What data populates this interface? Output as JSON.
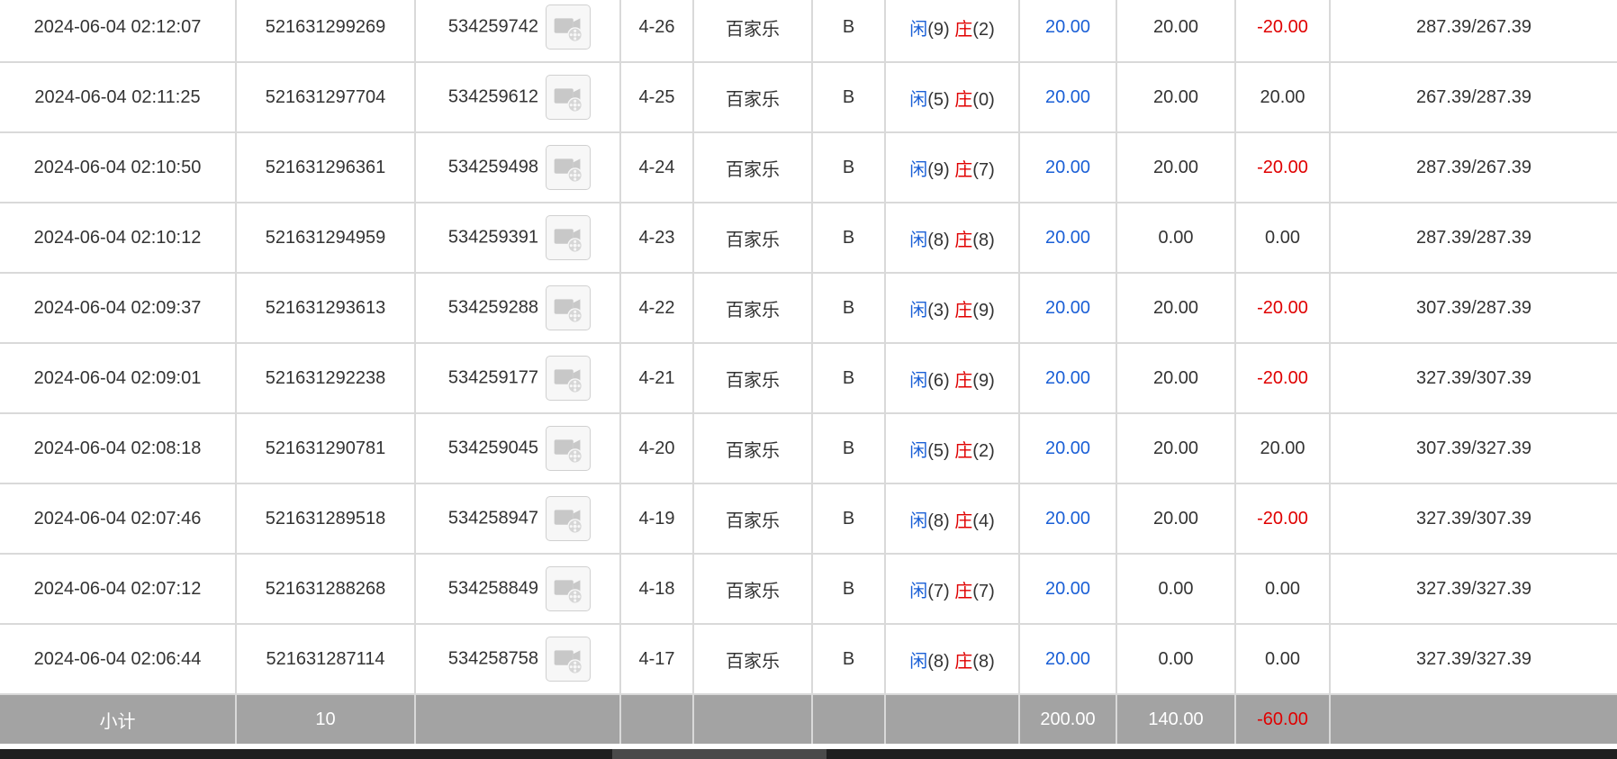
{
  "colors": {
    "player": "#1a5fd6",
    "banker": "#e00000",
    "negative": "#e00000",
    "subtotal_bg": "#a3a3a3"
  },
  "icons": {
    "video": "video-replay-icon"
  },
  "rows": [
    {
      "time": "2024-06-04 02:12:07",
      "bet_id": "521631299269",
      "game_id": "534259742",
      "round": "4-26",
      "game": "百家乐",
      "bet": "B",
      "player_label": "闲",
      "player": "(9)",
      "banker_label": "庄",
      "banker": "(2)",
      "bet_amount": "20.00",
      "valid_amount": "20.00",
      "win_loss": "-20.00",
      "negative": true,
      "balance": "287.39/267.39"
    },
    {
      "time": "2024-06-04 02:11:25",
      "bet_id": "521631297704",
      "game_id": "534259612",
      "round": "4-25",
      "game": "百家乐",
      "bet": "B",
      "player_label": "闲",
      "player": "(5)",
      "banker_label": "庄",
      "banker": "(0)",
      "bet_amount": "20.00",
      "valid_amount": "20.00",
      "win_loss": "20.00",
      "negative": false,
      "balance": "267.39/287.39"
    },
    {
      "time": "2024-06-04 02:10:50",
      "bet_id": "521631296361",
      "game_id": "534259498",
      "round": "4-24",
      "game": "百家乐",
      "bet": "B",
      "player_label": "闲",
      "player": "(9)",
      "banker_label": "庄",
      "banker": "(7)",
      "bet_amount": "20.00",
      "valid_amount": "20.00",
      "win_loss": "-20.00",
      "negative": true,
      "balance": "287.39/267.39"
    },
    {
      "time": "2024-06-04 02:10:12",
      "bet_id": "521631294959",
      "game_id": "534259391",
      "round": "4-23",
      "game": "百家乐",
      "bet": "B",
      "player_label": "闲",
      "player": "(8)",
      "banker_label": "庄",
      "banker": "(8)",
      "bet_amount": "20.00",
      "valid_amount": "0.00",
      "win_loss": "0.00",
      "negative": false,
      "balance": "287.39/287.39"
    },
    {
      "time": "2024-06-04 02:09:37",
      "bet_id": "521631293613",
      "game_id": "534259288",
      "round": "4-22",
      "game": "百家乐",
      "bet": "B",
      "player_label": "闲",
      "player": "(3)",
      "banker_label": "庄",
      "banker": "(9)",
      "bet_amount": "20.00",
      "valid_amount": "20.00",
      "win_loss": "-20.00",
      "negative": true,
      "balance": "307.39/287.39"
    },
    {
      "time": "2024-06-04 02:09:01",
      "bet_id": "521631292238",
      "game_id": "534259177",
      "round": "4-21",
      "game": "百家乐",
      "bet": "B",
      "player_label": "闲",
      "player": "(6)",
      "banker_label": "庄",
      "banker": "(9)",
      "bet_amount": "20.00",
      "valid_amount": "20.00",
      "win_loss": "-20.00",
      "negative": true,
      "balance": "327.39/307.39"
    },
    {
      "time": "2024-06-04 02:08:18",
      "bet_id": "521631290781",
      "game_id": "534259045",
      "round": "4-20",
      "game": "百家乐",
      "bet": "B",
      "player_label": "闲",
      "player": "(5)",
      "banker_label": "庄",
      "banker": "(2)",
      "bet_amount": "20.00",
      "valid_amount": "20.00",
      "win_loss": "20.00",
      "negative": false,
      "balance": "307.39/327.39"
    },
    {
      "time": "2024-06-04 02:07:46",
      "bet_id": "521631289518",
      "game_id": "534258947",
      "round": "4-19",
      "game": "百家乐",
      "bet": "B",
      "player_label": "闲",
      "player": "(8)",
      "banker_label": "庄",
      "banker": "(4)",
      "bet_amount": "20.00",
      "valid_amount": "20.00",
      "win_loss": "-20.00",
      "negative": true,
      "balance": "327.39/307.39"
    },
    {
      "time": "2024-06-04 02:07:12",
      "bet_id": "521631288268",
      "game_id": "534258849",
      "round": "4-18",
      "game": "百家乐",
      "bet": "B",
      "player_label": "闲",
      "player": "(7)",
      "banker_label": "庄",
      "banker": "(7)",
      "bet_amount": "20.00",
      "valid_amount": "0.00",
      "win_loss": "0.00",
      "negative": false,
      "balance": "327.39/327.39"
    },
    {
      "time": "2024-06-04 02:06:44",
      "bet_id": "521631287114",
      "game_id": "534258758",
      "round": "4-17",
      "game": "百家乐",
      "bet": "B",
      "player_label": "闲",
      "player": "(8)",
      "banker_label": "庄",
      "banker": "(8)",
      "bet_amount": "20.00",
      "valid_amount": "0.00",
      "win_loss": "0.00",
      "negative": false,
      "balance": "327.39/327.39"
    }
  ],
  "subtotal": {
    "label": "小计",
    "count": "10",
    "bet_amount": "200.00",
    "valid_amount": "140.00",
    "win_loss": "-60.00"
  }
}
